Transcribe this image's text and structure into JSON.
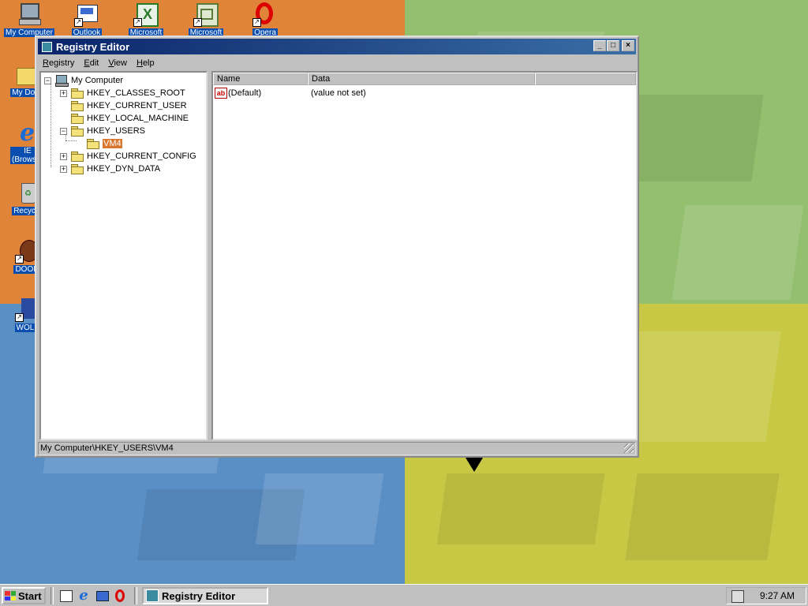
{
  "desktop": {
    "icons": [
      {
        "label": "My Computer",
        "icon": "my-computer-icon"
      },
      {
        "label": "Outlook",
        "icon": "outlook-icon"
      },
      {
        "label": "Microsoft",
        "icon": "excel-icon"
      },
      {
        "label": "Microsoft",
        "icon": "project-icon"
      },
      {
        "label": "Opera",
        "icon": "opera-icon"
      },
      {
        "label": "My Docu",
        "icon": "my-documents-icon"
      },
      {
        "label": "IE (Browser",
        "icon": "internet-explorer-icon"
      },
      {
        "label": "Recycle",
        "icon": "recycle-bin-icon"
      },
      {
        "label": "DOOM",
        "icon": "doom-icon"
      },
      {
        "label": "WOLF",
        "icon": "wolfenstein-icon"
      }
    ]
  },
  "window": {
    "title": "Registry Editor",
    "buttons": {
      "minimize": "_",
      "maximize": "□",
      "close": "×"
    },
    "menu": [
      {
        "label": "Registry",
        "accel": "R",
        "rest": "egistry"
      },
      {
        "label": "Edit",
        "accel": "E",
        "rest": "dit"
      },
      {
        "label": "View",
        "accel": "V",
        "rest": "iew"
      },
      {
        "label": "Help",
        "accel": "H",
        "rest": "elp"
      }
    ],
    "tree": {
      "root": "My Computer",
      "keys": [
        {
          "label": "HKEY_CLASSES_ROOT",
          "expander": "+"
        },
        {
          "label": "HKEY_CURRENT_USER",
          "expander": ""
        },
        {
          "label": "HKEY_LOCAL_MACHINE",
          "expander": ""
        },
        {
          "label": "HKEY_USERS",
          "expander": "−"
        },
        {
          "label": "VM4",
          "expander": "",
          "selected": true
        },
        {
          "label": "HKEY_CURRENT_CONFIG",
          "expander": "+"
        },
        {
          "label": "HKEY_DYN_DATA",
          "expander": "+"
        }
      ]
    },
    "list": {
      "columns": [
        "Name",
        "Data"
      ],
      "rows": [
        {
          "icon": "ab-string-icon",
          "icon_text": "ab",
          "name": "(Default)",
          "data": "(value not set)"
        }
      ]
    },
    "status": "My Computer\\HKEY_USERS\\VM4"
  },
  "taskbar": {
    "start_label": "Start",
    "active_task": "Registry Editor",
    "clock": "9:27 AM"
  },
  "colors": {
    "titlebar": "#0a246a",
    "selection": "#d9772f",
    "face": "#c0c0c0"
  }
}
